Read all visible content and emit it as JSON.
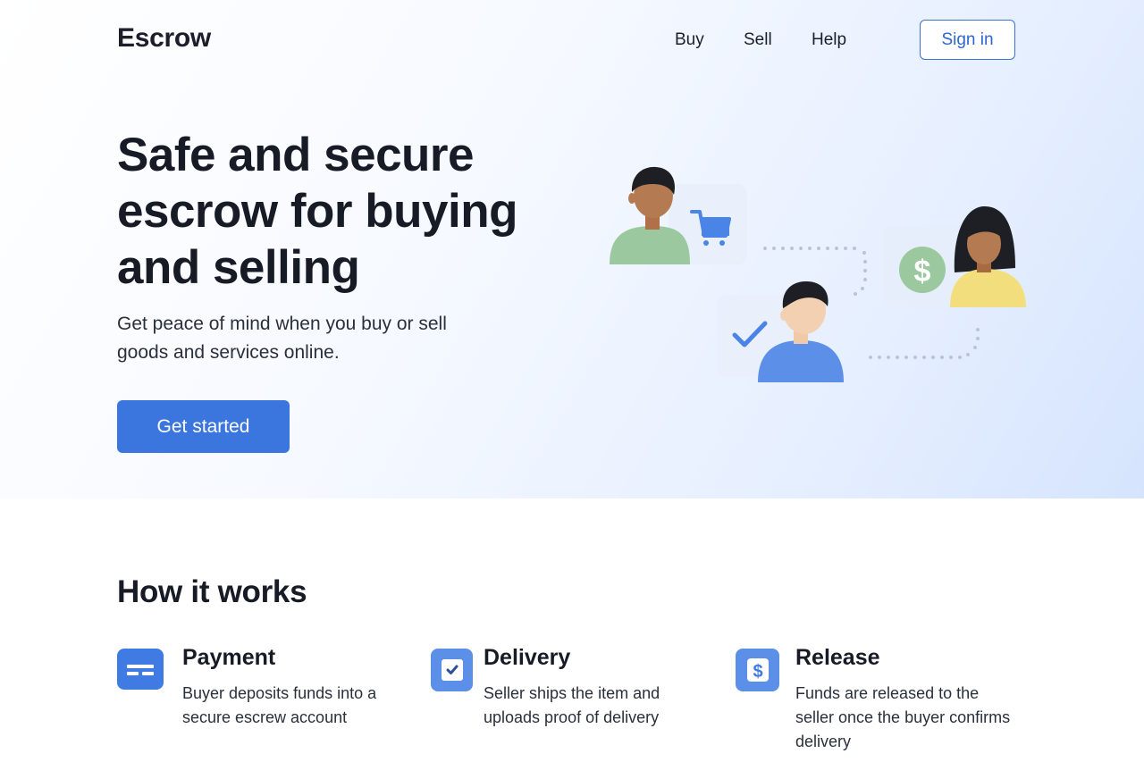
{
  "header": {
    "logo": "Escrow",
    "nav": [
      {
        "label": "Buy"
      },
      {
        "label": "Sell"
      },
      {
        "label": "Help"
      }
    ],
    "signin_label": "Sign in"
  },
  "hero": {
    "title_lines": [
      "Safe and secure",
      "escrow for buying",
      "and selling"
    ],
    "subtitle_lines": [
      "Get peace of mind when you buy or sell",
      "goods and services online."
    ],
    "cta_label": "Get started",
    "illustration": {
      "icons": [
        "cart-icon",
        "dollar-icon",
        "checkmark-icon"
      ],
      "people": [
        "buyer-avatar",
        "seller-avatar",
        "agent-avatar"
      ]
    }
  },
  "how_it_works": {
    "title": "How it works",
    "steps": [
      {
        "icon": "card-icon",
        "title": "Payment",
        "desc_lines": [
          "Buyer deposits funds into a",
          "secure escrew account"
        ]
      },
      {
        "icon": "checkbox-icon",
        "title": "Delivery",
        "desc_lines": [
          "Seller ships the item and",
          "uploads proof of delivery"
        ]
      },
      {
        "icon": "dollar-icon",
        "title": "Release",
        "desc_lines": [
          "Funds are released to the",
          "seller once the buyer confirms",
          "delivery"
        ]
      }
    ]
  },
  "colors": {
    "accent": "#3b75de",
    "text": "#161b26",
    "hero_gradient_end": "#d5e4fd",
    "green_shirt": "#9bc89e",
    "yellow_shirt": "#f3de7e",
    "blue_shirt": "#5b8fe8",
    "dollar_badge": "#9bc89e"
  }
}
